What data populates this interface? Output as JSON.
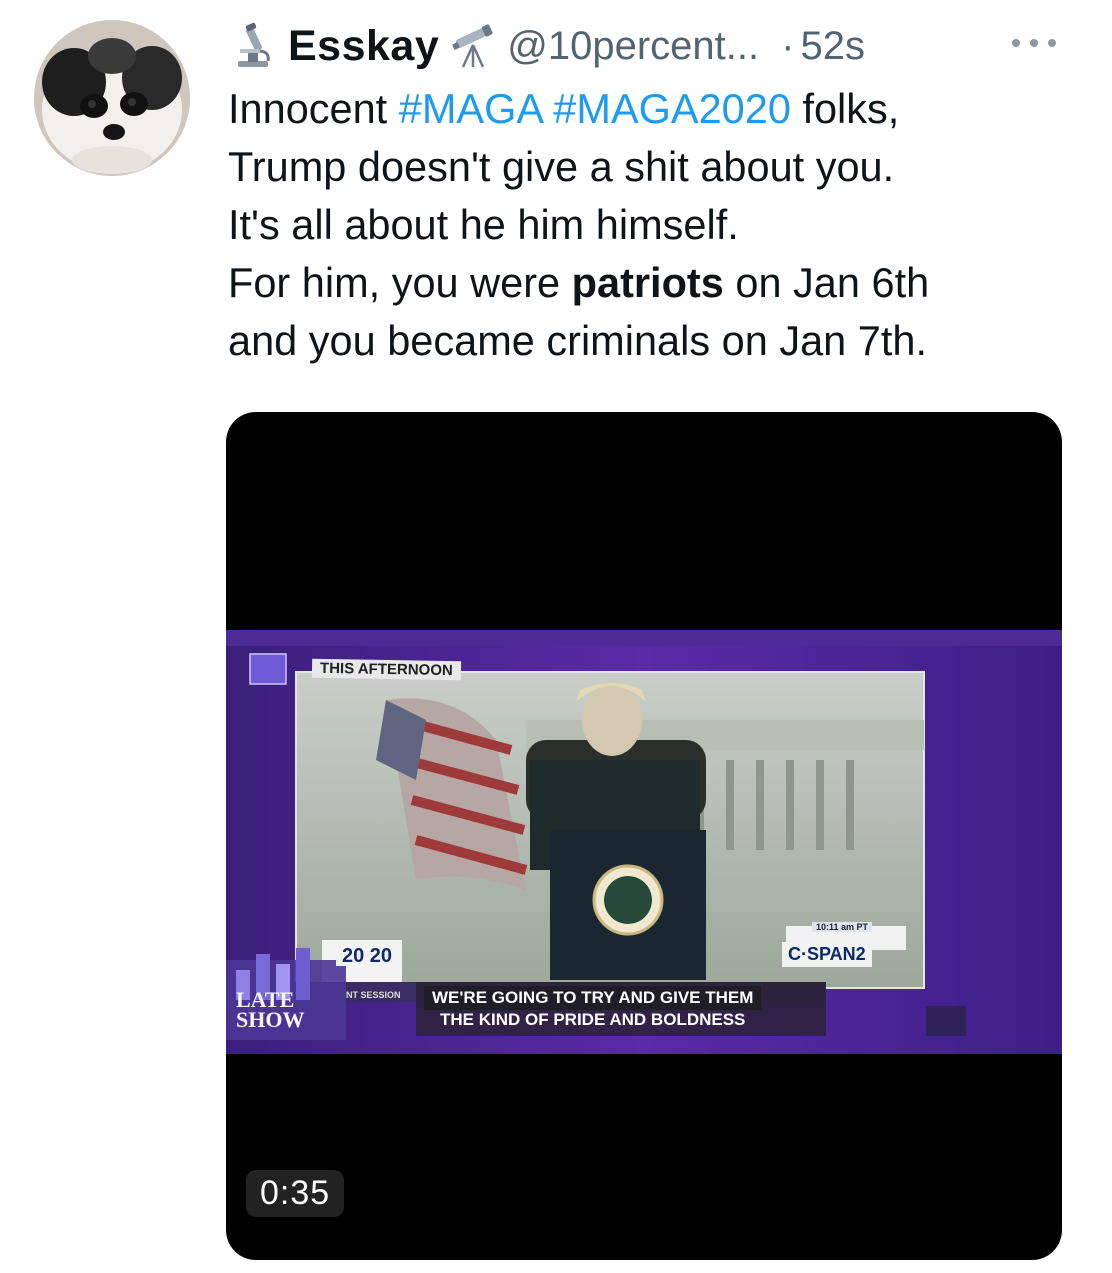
{
  "author": {
    "display_name": "Esskay",
    "handle": "@10percent...",
    "separator": "·",
    "time": "52s",
    "left_emoji": "microscope-icon",
    "right_emoji": "telescope-icon"
  },
  "tweet": {
    "line1": {
      "prefix": "Innocent ",
      "tag1": "#MAGA",
      "space": " ",
      "tag2": "#MAGA2020",
      "suffix": " folks,"
    },
    "line2": "Trump doesn't give a shit about you.",
    "line3": "It's all about he him himself.",
    "line4": {
      "prefix": "For him, you were ",
      "bold": "patriots",
      "suffix": " on Jan 6th"
    },
    "line5": "and you became criminals on Jan 7th."
  },
  "media": {
    "duration": "0:35",
    "overlay": {
      "this_afternoon": "THIS AFTERNOON",
      "cspan": "C·SPAN2",
      "clock": "10:11 am PT",
      "caption_line1": "WE'RE GOING TO TRY AND GIVE THEM",
      "caption_line2": "THE KIND OF PRIDE AND BOLDNESS",
      "session": "NT SESSION",
      "year": "20 20",
      "late": "LATE",
      "show": "SHOW"
    }
  },
  "colors": {
    "hashtag": "#1d9bf0",
    "text": "#0f1419",
    "secondary": "#536471"
  }
}
